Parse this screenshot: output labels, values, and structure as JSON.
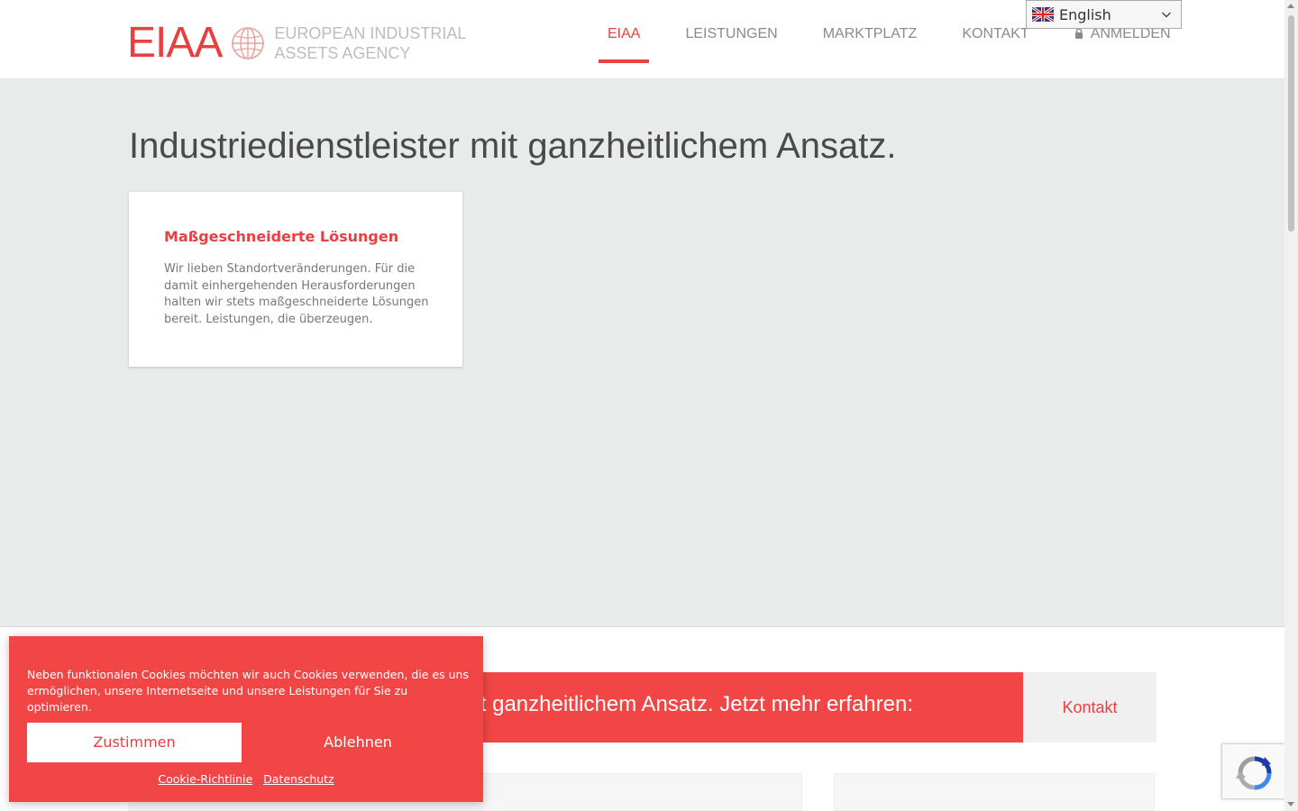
{
  "brand": {
    "mark": "EIAA",
    "name_line1": "EUROPEAN INDUSTRIAL",
    "name_line2": "ASSETS AGENCY",
    "accent_color": "#e84040",
    "logo_icon": "globe-icon"
  },
  "nav": {
    "items": [
      {
        "label": "EIAA",
        "active": true
      },
      {
        "label": "LEISTUNGEN",
        "active": false
      },
      {
        "label": "MARKTPLATZ",
        "active": false
      },
      {
        "label": "KONTAKT",
        "active": false
      },
      {
        "label": "ANMELDEN",
        "active": false,
        "icon": "lock-icon"
      }
    ]
  },
  "language": {
    "selected": "English",
    "flag_icon": "uk-flag-icon"
  },
  "hero": {
    "title": "Industriedienstleister mit ganzheitlichem Ansatz.",
    "background": "#e9ebea",
    "card": {
      "title": "Maßgeschneiderte Lösungen",
      "text": "Wir lieben Standortveränderungen. Für die damit einhergehenden Herausforderungen halten wir stets maßgeschneiderte Lösungen bereit. Leistungen, die überzeugen."
    }
  },
  "cta": {
    "text": "t ganzheitlichem Ansatz. Jetzt mehr erfahren:",
    "button_label": "Kontakt",
    "bar_color": "#f24545"
  },
  "cookie_banner": {
    "text": "Neben funktionalen Cookies möchten wir auch Cookies verwenden, die es uns ermöglichen, unsere Internetseite und unsere Leistungen für Sie zu optimieren.",
    "accept_label": "Zustimmen",
    "decline_label": "Ablehnen",
    "links": [
      "Cookie-Richtlinie",
      "Datenschutz"
    ]
  },
  "recaptcha": {
    "icon": "recaptcha-icon"
  }
}
